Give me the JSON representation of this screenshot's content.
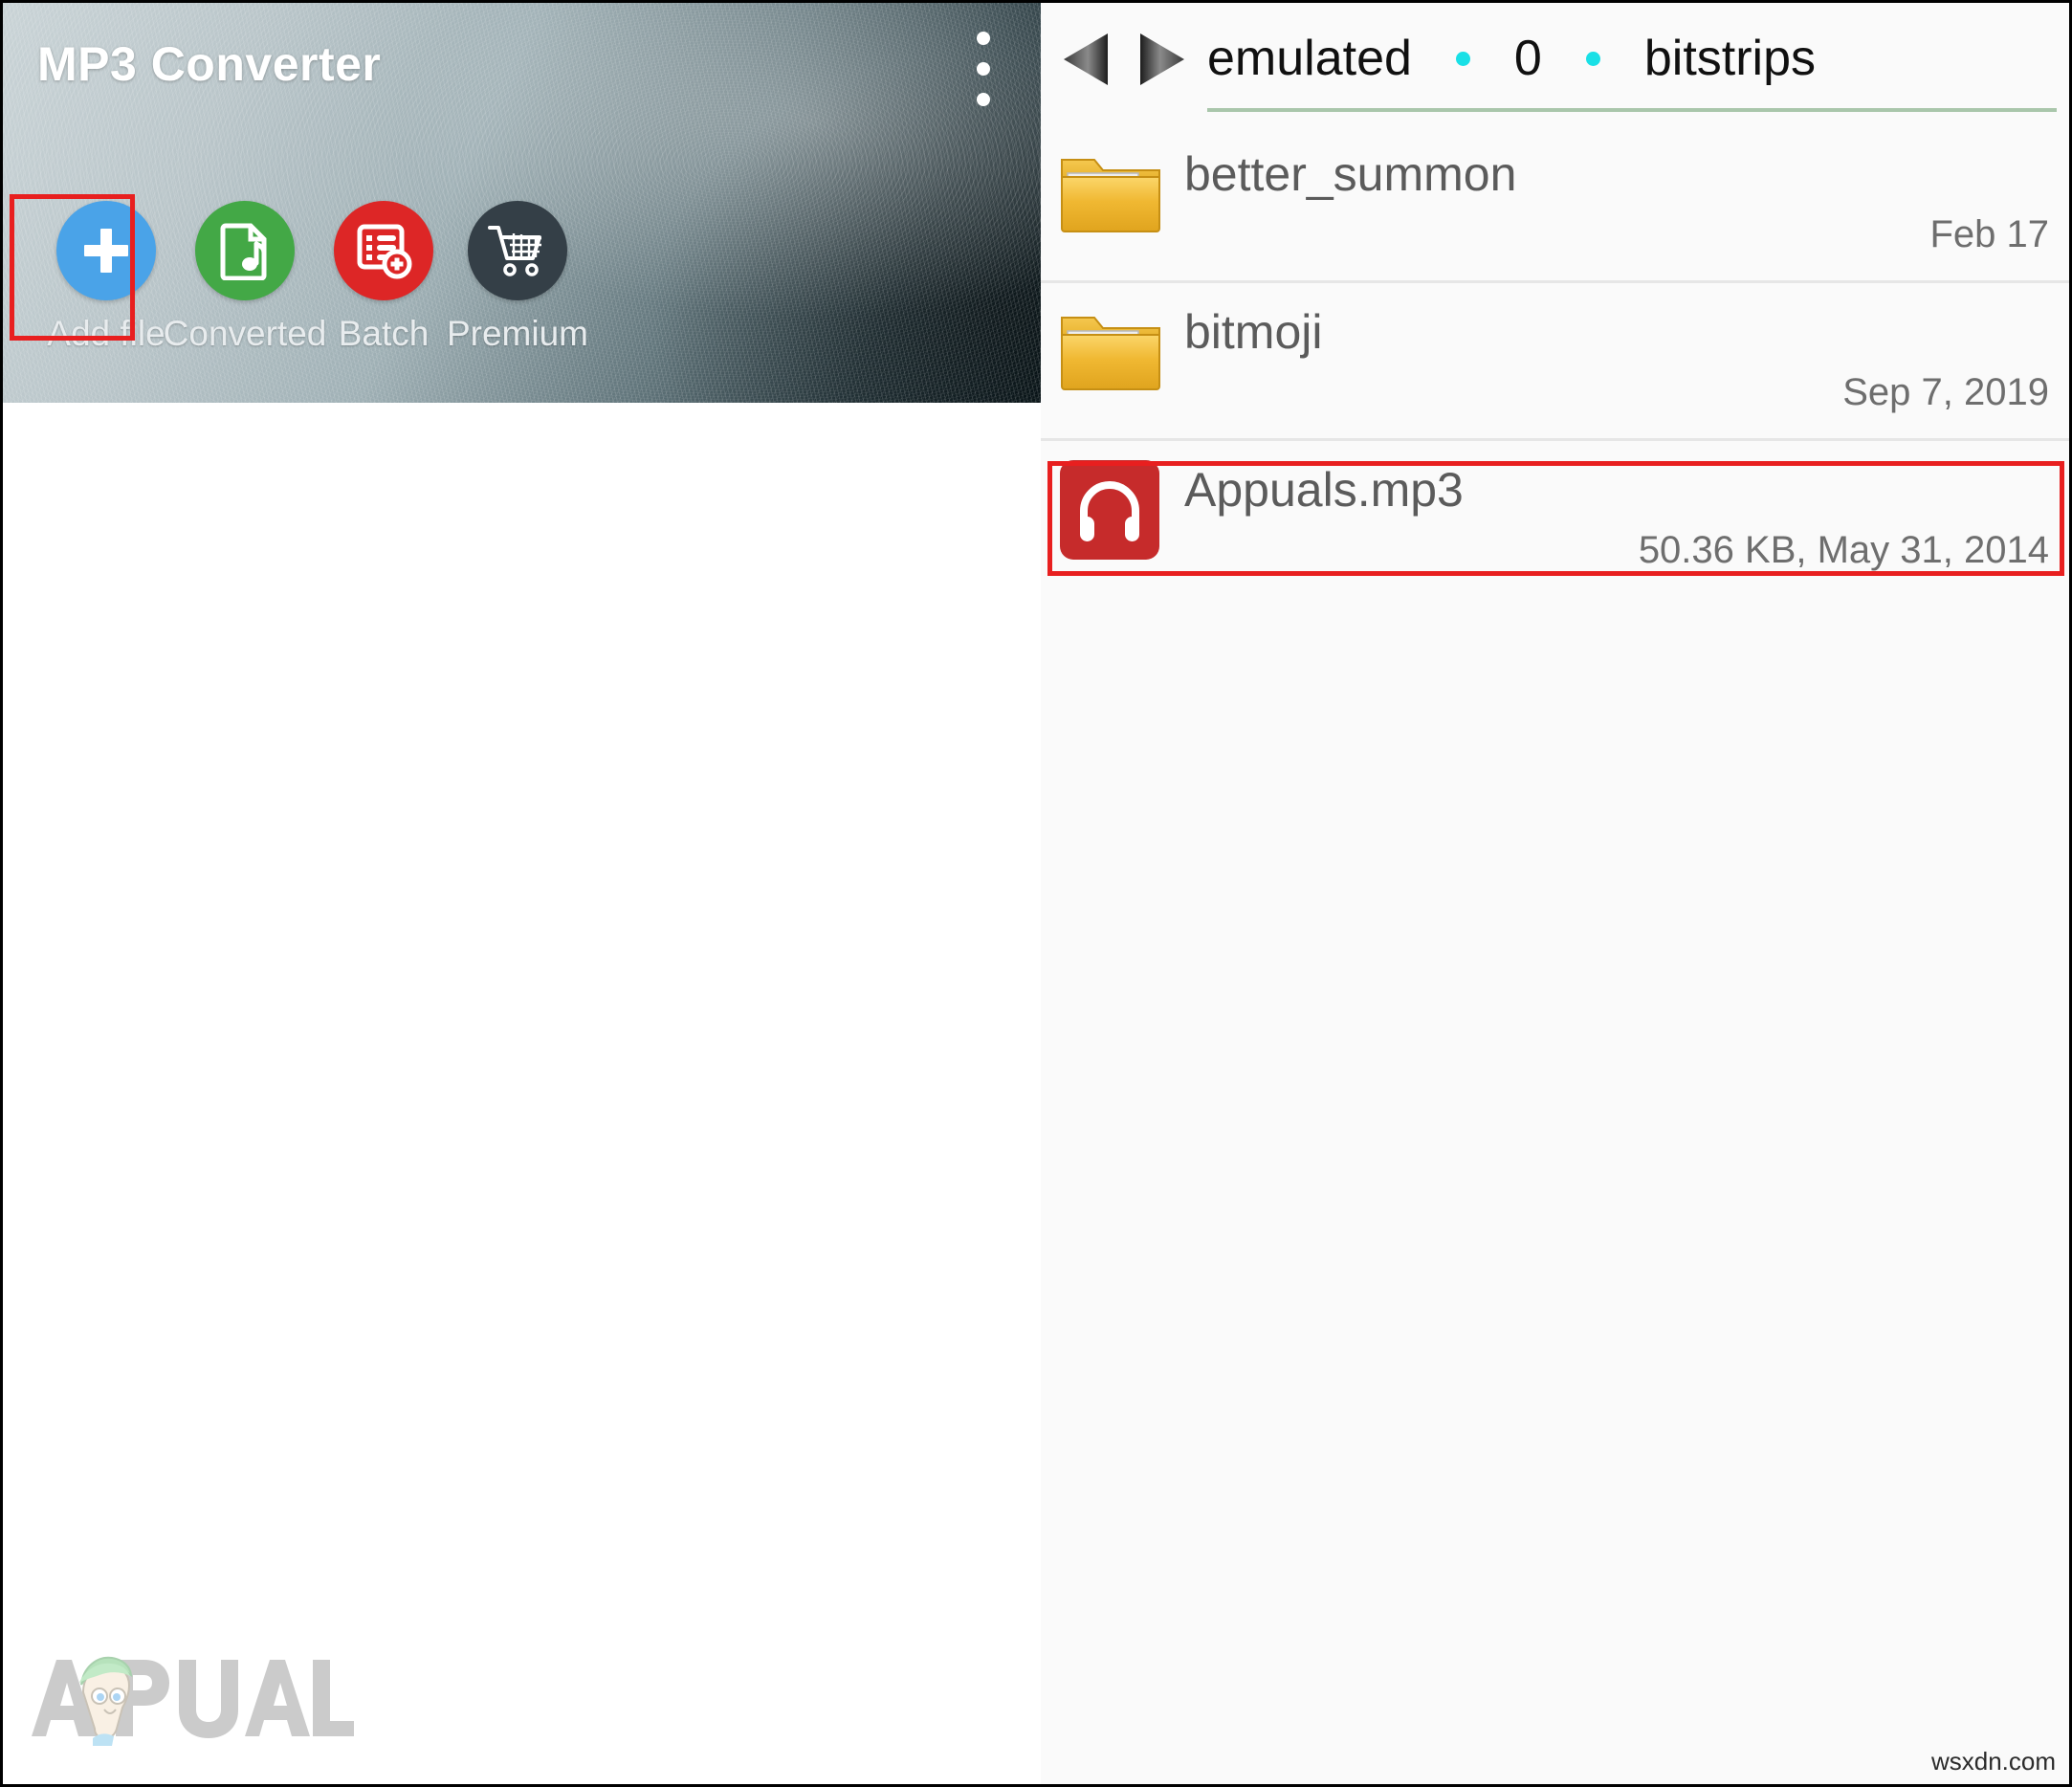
{
  "app": {
    "title": "MP3 Converter",
    "overflow_menu_icon": "more-vertical-icon",
    "toolbar": [
      {
        "id": "add-file",
        "label": "Add file",
        "icon": "plus-icon",
        "color": "#4aa3e8",
        "highlighted": true
      },
      {
        "id": "converted",
        "label": "Converted",
        "icon": "music-file-icon",
        "color": "#43a846",
        "highlighted": false
      },
      {
        "id": "batch",
        "label": "Batch",
        "icon": "list-add-icon",
        "color": "#dd2626",
        "highlighted": false
      },
      {
        "id": "premium",
        "label": "Premium",
        "icon": "shopping-cart-icon",
        "color": "#343f47",
        "highlighted": false
      }
    ]
  },
  "browser": {
    "nav": {
      "back_icon": "triangle-left-icon",
      "forward_icon": "triangle-right-icon"
    },
    "breadcrumb": {
      "separator_color": "#19e0e6",
      "underline_color": "#a9c6ab",
      "crumbs": [
        "emulated",
        "0",
        "bitstrips"
      ]
    },
    "files": [
      {
        "name": "better_summon",
        "meta": "Feb 17",
        "type": "folder",
        "icon": "folder-icon",
        "selected": false
      },
      {
        "name": "bitmoji",
        "meta": "Sep 7, 2019",
        "type": "folder",
        "icon": "folder-icon",
        "selected": false
      },
      {
        "name": "Appuals.mp3",
        "meta": "50.36 KB, May 31, 2014",
        "type": "audio",
        "icon": "headphones-icon",
        "selected": true
      }
    ]
  },
  "watermarks": {
    "logo_text": "APPUALS",
    "site": "wsxdn.com"
  },
  "highlight_color": "#e81f1f"
}
